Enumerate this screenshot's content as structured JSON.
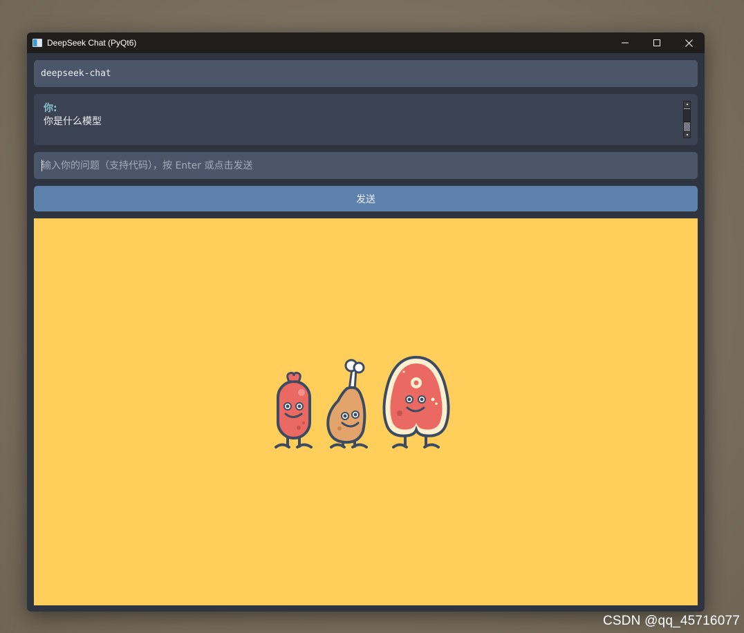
{
  "window": {
    "title": "DeepSeek Chat (PyQt6)",
    "controls": {
      "minimize_icon": "minimize-icon",
      "maximize_icon": "maximize-icon",
      "close_icon": "close-icon"
    }
  },
  "model_field": {
    "value": "deepseek-chat"
  },
  "chat": {
    "messages": [
      {
        "speaker": "你:",
        "text": "你是什么模型"
      }
    ]
  },
  "question_input": {
    "value": "",
    "placeholder": "输入你的问题（支持代码），按 Enter 或点击发送"
  },
  "send_button": {
    "label": "发送"
  },
  "image_panel": {
    "illustration": "sausage-drumstick-steak-characters"
  },
  "watermark": {
    "text": "CSDN @qq_45716077"
  },
  "colors": {
    "window_bg": "#2e3440",
    "titlebar_bg": "#1f1e1c",
    "input_bg": "#4c566a",
    "chat_bg": "#3b4252",
    "button_bg": "#5e81ac",
    "speaker_color": "#88c0d0",
    "image_bg": "#ffce5b"
  }
}
